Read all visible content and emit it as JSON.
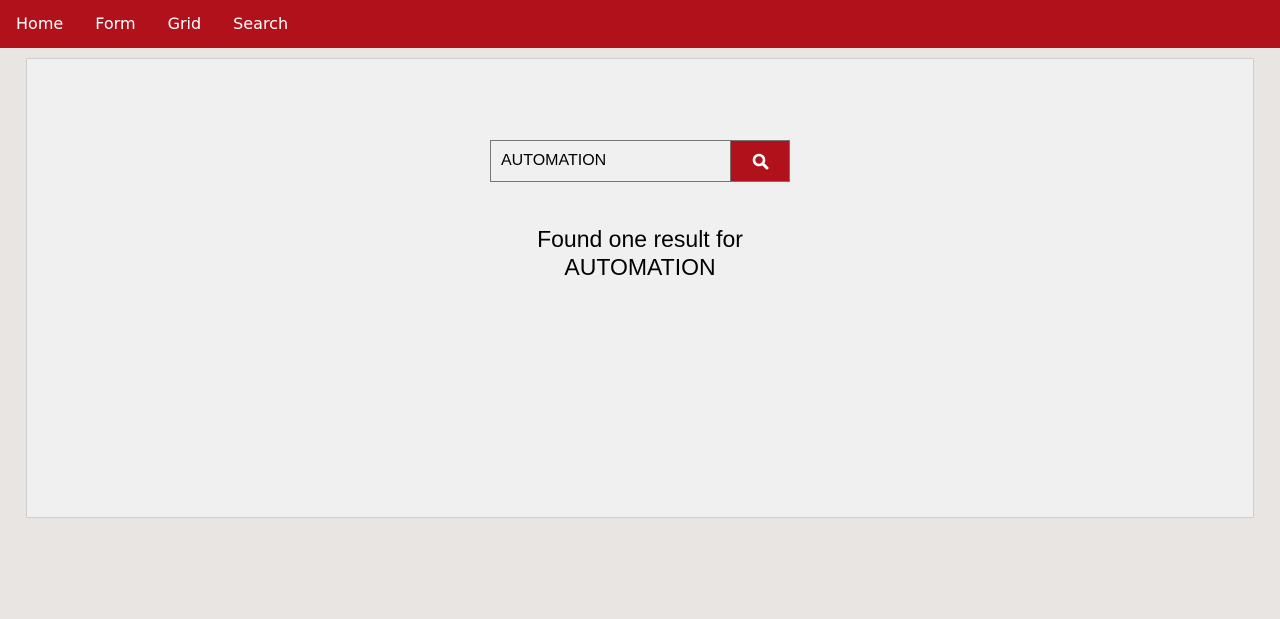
{
  "nav": {
    "items": [
      {
        "label": "Home"
      },
      {
        "label": "Form"
      },
      {
        "label": "Grid"
      },
      {
        "label": "Search"
      }
    ]
  },
  "search": {
    "value": "AUTOMATION",
    "button_icon": "search-icon"
  },
  "result": {
    "line1": "Found one result for",
    "line2": "AUTOMATION"
  },
  "colors": {
    "brand": "#b0111b",
    "panel": "#f0f0f0",
    "page": "#e9e5e3"
  }
}
